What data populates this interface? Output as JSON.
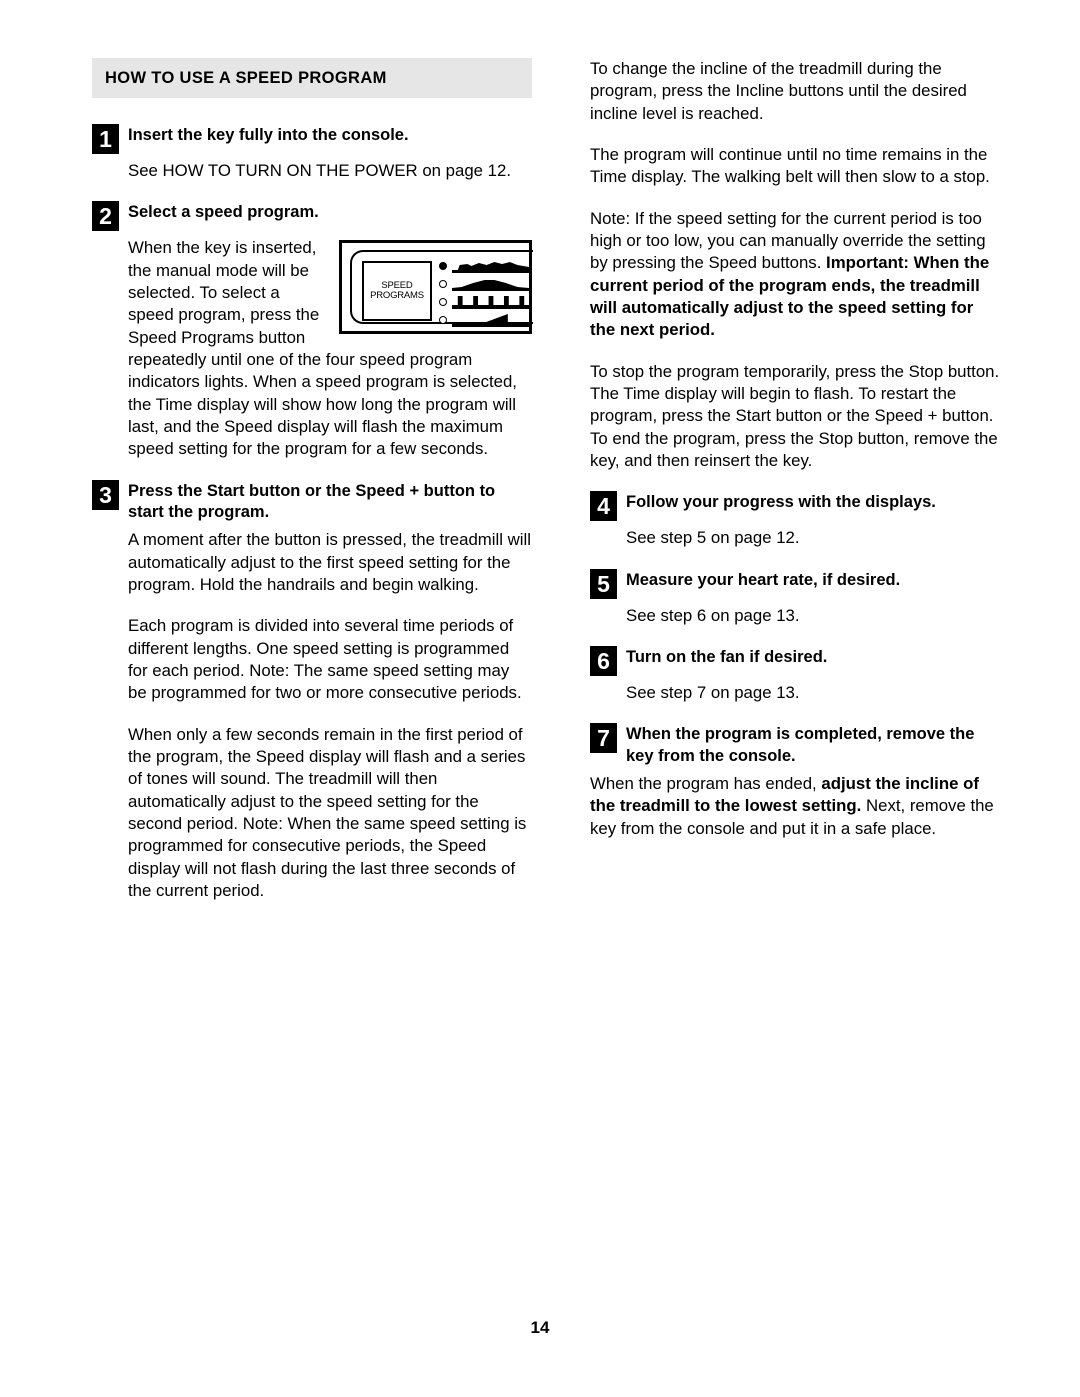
{
  "document": {
    "page_number": "14",
    "section_heading": "HOW TO USE A SPEED PROGRAM"
  },
  "left_column": {
    "step1": {
      "number": "1",
      "title": "Insert the key fully into the console.",
      "body": "See HOW TO TURN ON THE POWER on page 12."
    },
    "step2": {
      "number": "2",
      "title": "Select a speed program.",
      "body1": "When the key is inserted, the manual mode will be selected. To select a speed program, press the Speed Programs button repeatedly until one of the four speed program indicators lights. When a speed program is selected, the Time display will show how long the program will last, and the Speed display will flash the maximum speed setting for the program for a few seconds."
    },
    "step3": {
      "number": "3",
      "title": "Press the Start button or the Speed + button to start the program.",
      "body1": "A moment after the button is pressed, the treadmill will automatically adjust to the first speed setting for the program. Hold the handrails and begin walking.",
      "body2": "Each program is divided into several time periods of different lengths. One speed setting is programmed for each period. Note: The same speed setting may be programmed for two or more consecutive periods.",
      "body3": "When only a few seconds remain in the first period of the program, the Speed display will flash and a series of tones will sound. The treadmill will then automatically adjust to the speed setting for the second period. Note: When the same speed setting is programmed for consecutive periods, the Speed display will not flash during the last three seconds of the current period."
    }
  },
  "figure": {
    "label_line1": "SPEED",
    "label_line2": "PROGRAMS",
    "indicators": [
      {
        "state": "on",
        "profile": "bumpy-plateau"
      },
      {
        "state": "off",
        "profile": "smooth-hill"
      },
      {
        "state": "off",
        "profile": "interval-spikes"
      },
      {
        "state": "off",
        "profile": "ramp-up"
      }
    ]
  },
  "right_column": {
    "para_incline": "To change the incline of the treadmill during the program, press the Incline buttons until the desired incline level is reached.",
    "para_continue": "The program will continue until no time remains in the Time display. The walking belt will then slow to a stop.",
    "para_note_plain": "Note: If the speed setting for the current period is too high or too low, you can manually override the setting by pressing the Speed buttons. ",
    "para_note_bold": "Important: When the current period of the program ends, the treadmill will automatically adjust to the speed setting for the next period.",
    "para_stop": "To stop the program temporarily, press the Stop button. The Time display will begin to flash. To restart the program, press the Start button or the Speed + button. To end the program, press the Stop button, remove the key, and then reinsert the key.",
    "step4": {
      "number": "4",
      "title": "Follow your progress with the displays.",
      "body": "See step 5 on page 12."
    },
    "step5": {
      "number": "5",
      "title": "Measure your heart rate, if desired.",
      "body": "See step 6 on page 13."
    },
    "step6": {
      "number": "6",
      "title": "Turn on the fan if desired.",
      "body": "See step 7 on page 13."
    },
    "step7": {
      "number": "7",
      "title": "When the program is completed, remove the key from the console.",
      "body_part1": "When the program has ended, ",
      "body_bold": "adjust the incline of the treadmill to the lowest setting.",
      "body_part2": " Next, remove the key from the console and put it in a safe place."
    }
  }
}
